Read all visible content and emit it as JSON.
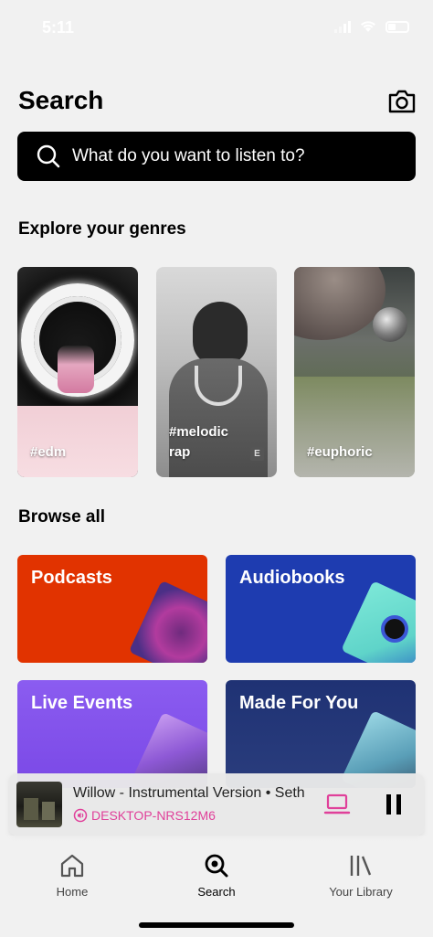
{
  "status_bar": {
    "time": "5:11"
  },
  "header": {
    "title": "Search"
  },
  "search": {
    "placeholder": "What do you want to listen to?"
  },
  "genres": {
    "title": "Explore your genres",
    "items": [
      {
        "label": "#edm",
        "explicit": false
      },
      {
        "label": "#melodic\nrap",
        "explicit": true,
        "explicit_badge": "E"
      },
      {
        "label": "#euphoric",
        "explicit": false
      }
    ]
  },
  "browse": {
    "title": "Browse all",
    "items": [
      {
        "label": "Podcasts",
        "color": "#e13300"
      },
      {
        "label": "Audiobooks",
        "color": "#1e3264"
      },
      {
        "label": "Live Events",
        "color": "#8d67ab"
      },
      {
        "label": "Made For You",
        "color": "#1e3264"
      }
    ]
  },
  "now_playing": {
    "title": "Willow - Instrumental Version • Seth",
    "device": "DESKTOP-NRS12M6",
    "accent_color": "#e0409a"
  },
  "nav": {
    "items": [
      {
        "label": "Home",
        "icon": "home-icon"
      },
      {
        "label": "Search",
        "icon": "search-icon"
      },
      {
        "label": "Your Library",
        "icon": "library-icon"
      }
    ]
  }
}
